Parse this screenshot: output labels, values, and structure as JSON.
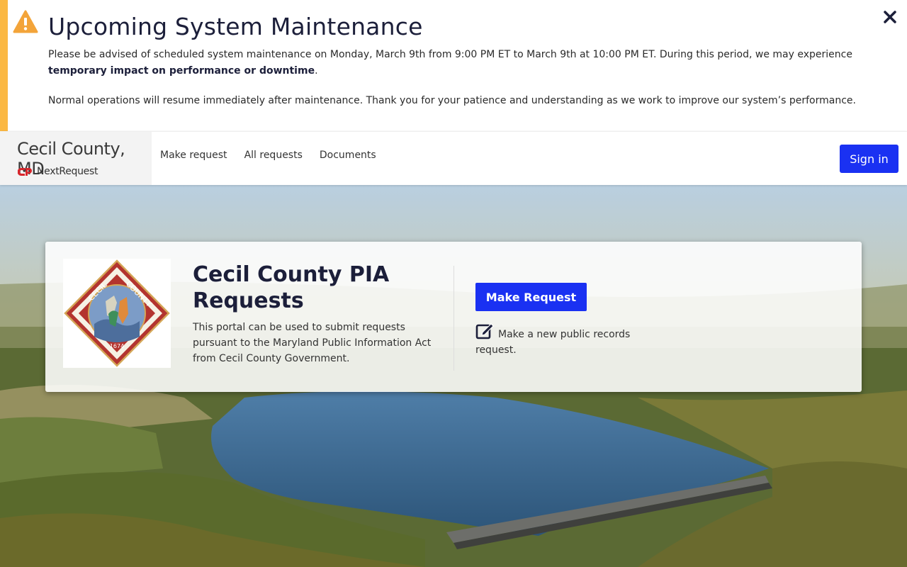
{
  "banner": {
    "title": "Upcoming System Maintenance",
    "line1_a": "Please be advised of scheduled system maintenance on Monday, March 9th from 9:00 PM ET to March 9th at 10:00 PM ET. During this period, we may experience ",
    "line1_bold": "temporary impact on performance or downtime",
    "line1_end": ".",
    "line2": "Normal operations will resume immediately after maintenance. Thank you for your patience and understanding as we work to improve our system’s performance.",
    "warning_icon": "warning-icon",
    "close_icon": "close-icon",
    "accent_color": "#fbb843"
  },
  "nav": {
    "brand_name": "Cecil County, MD",
    "brand_sub": "NextRequest",
    "links": [
      "Make request",
      "All requests",
      "Documents"
    ],
    "signin_label": "Sign in",
    "accent_color": "#1a31f2"
  },
  "card": {
    "title": "Cecil County PIA Requests",
    "description": "This portal can be used to submit requests pursuant to the Maryland Public Information Act from Cecil County Government.",
    "button_label": "Make Request",
    "note": "Make a new public records request.",
    "seal": {
      "top_text": "CECIL COUNTY",
      "year": "1674"
    }
  }
}
